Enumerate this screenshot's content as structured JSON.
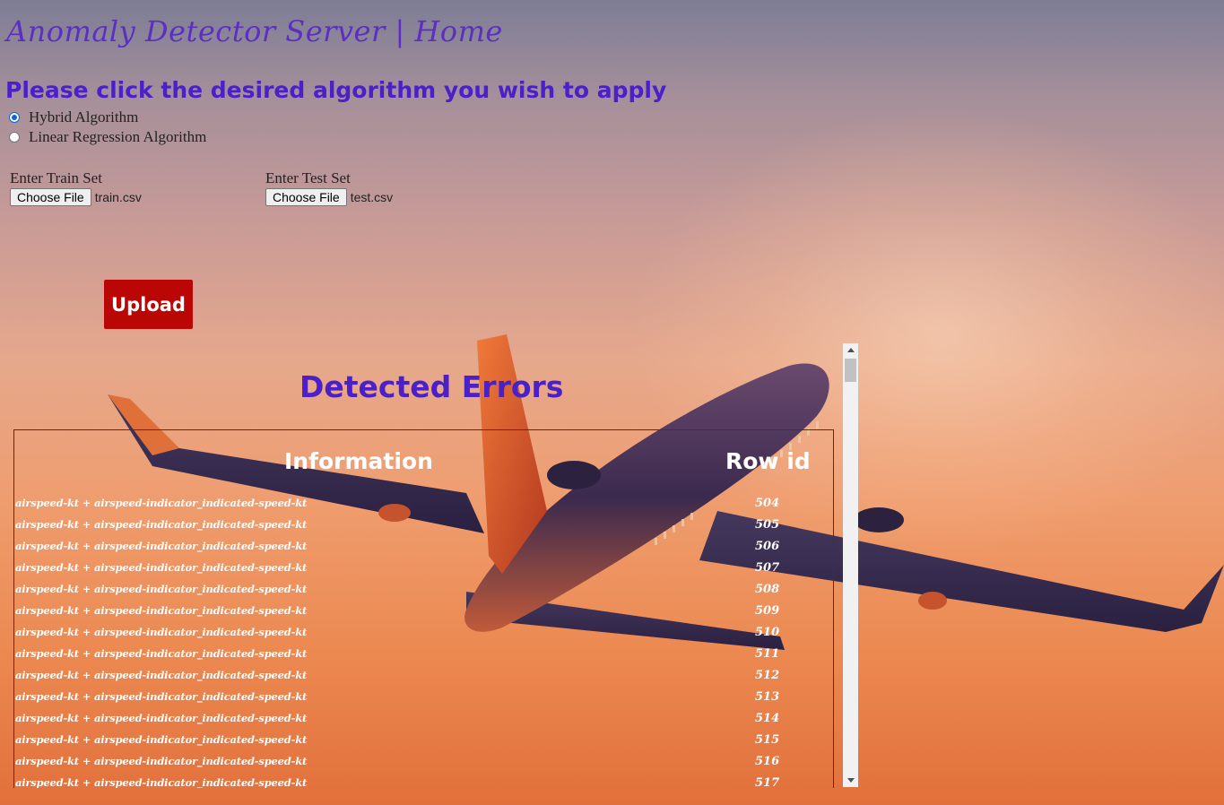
{
  "header": {
    "title": "Anomaly Detector Server | Home"
  },
  "algorithm": {
    "prompt": "Please click the desired algorithm you wish to apply",
    "options": [
      {
        "label": "Hybrid Algorithm",
        "checked": true
      },
      {
        "label": "Linear Regression Algorithm",
        "checked": false
      }
    ]
  },
  "train": {
    "label": "Enter Train Set",
    "button": "Choose File",
    "file": "train.csv"
  },
  "test": {
    "label": "Enter Test Set",
    "button": "Choose File",
    "file": "test.csv"
  },
  "upload": {
    "label": "Upload"
  },
  "results": {
    "title": "Detected Errors",
    "columns": [
      "Information",
      "Row id"
    ],
    "rows": [
      {
        "info": "airspeed-kt + airspeed-indicator_indicated-speed-kt",
        "id": "504"
      },
      {
        "info": "airspeed-kt + airspeed-indicator_indicated-speed-kt",
        "id": "505"
      },
      {
        "info": "airspeed-kt + airspeed-indicator_indicated-speed-kt",
        "id": "506"
      },
      {
        "info": "airspeed-kt + airspeed-indicator_indicated-speed-kt",
        "id": "507"
      },
      {
        "info": "airspeed-kt + airspeed-indicator_indicated-speed-kt",
        "id": "508"
      },
      {
        "info": "airspeed-kt + airspeed-indicator_indicated-speed-kt",
        "id": "509"
      },
      {
        "info": "airspeed-kt + airspeed-indicator_indicated-speed-kt",
        "id": "510"
      },
      {
        "info": "airspeed-kt + airspeed-indicator_indicated-speed-kt",
        "id": "511"
      },
      {
        "info": "airspeed-kt + airspeed-indicator_indicated-speed-kt",
        "id": "512"
      },
      {
        "info": "airspeed-kt + airspeed-indicator_indicated-speed-kt",
        "id": "513"
      },
      {
        "info": "airspeed-kt + airspeed-indicator_indicated-speed-kt",
        "id": "514"
      },
      {
        "info": "airspeed-kt + airspeed-indicator_indicated-speed-kt",
        "id": "515"
      },
      {
        "info": "airspeed-kt + airspeed-indicator_indicated-speed-kt",
        "id": "516"
      },
      {
        "info": "airspeed-kt + airspeed-indicator_indicated-speed-kt",
        "id": "517"
      }
    ]
  },
  "theme": {
    "accent": "#4b20c8",
    "upload_bg": "#bb0606"
  }
}
